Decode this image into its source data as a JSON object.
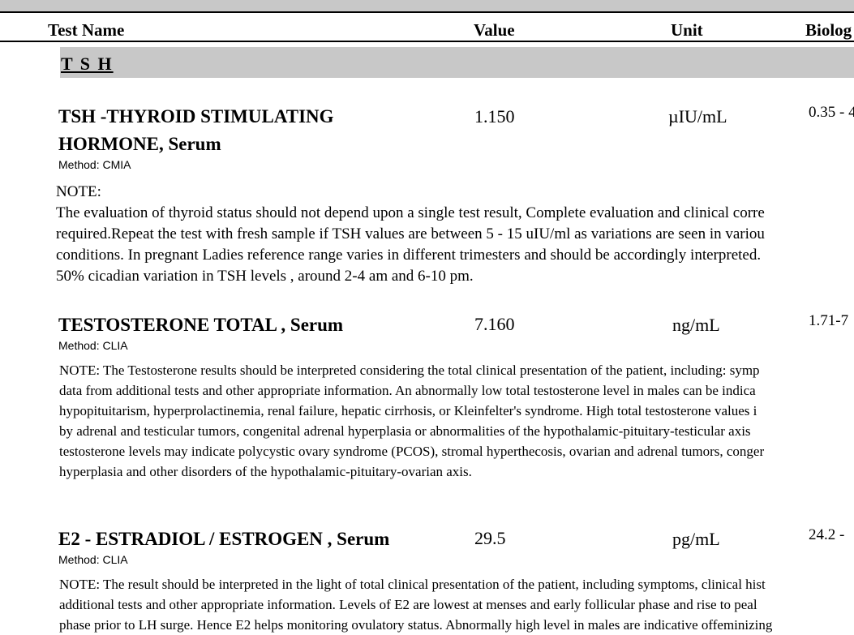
{
  "header": {
    "test_name": "Test Name",
    "value": "Value",
    "unit": "Unit",
    "bio": "Biolog"
  },
  "section": {
    "title": "T S H"
  },
  "tests": [
    {
      "name": "TSH -THYROID STIMULATING HORMONE, Serum",
      "method": "Method: CMIA",
      "value": "1.150",
      "unit": "µIU/mL",
      "range": "0.35 - 4",
      "note_lines": [
        "NOTE:",
        "The evaluation of thyroid status should not depend upon a single test result, Complete evaluation and clinical corre",
        "required.Repeat the test with fresh sample if TSH values are between 5 - 15 uIU/ml as variations are seen in variou",
        "conditions. In pregnant Ladies reference range varies in different trimesters and should be accordingly interpreted.",
        "50% cicadian variation in TSH levels , around 2-4 am and 6-10 pm."
      ]
    },
    {
      "name": "TESTOSTERONE TOTAL , Serum",
      "method": "Method: CLIA",
      "value": "7.160",
      "unit": "ng/mL",
      "range": "1.71-7",
      "note_lines": [
        "NOTE: The Testosterone results should be interpreted considering the total clinical presentation of the patient, including: symp",
        "data from additional tests and other appropriate information. An abnormally low total testosterone level in males can be indica",
        "hypopituitarism, hyperprolactinemia, renal failure, hepatic cirrhosis, or Kleinfelter's syndrome. High total testosterone values i",
        "by adrenal and testicular tumors, congenital adrenal hyperplasia or abnormalities of the hypothalamic-pituitary-testicular axis",
        "testosterone levels may indicate polycystic ovary syndrome (PCOS), stromal hyperthecosis, ovarian and adrenal tumors, conger",
        "hyperplasia and other disorders of the hypothalamic-pituitary-ovarian axis."
      ]
    },
    {
      "name": "E2 - ESTRADIOL / ESTROGEN , Serum",
      "method": "Method: CLIA",
      "value": "29.5",
      "unit": "pg/mL",
      "range": "24.2 -",
      "note_lines": [
        "NOTE: The result should be interpreted in the light of total clinical presentation of the patient, including symptoms, clinical hist",
        "additional tests and other appropriate information. Levels of E2 are lowest at menses and early follicular phase and rise to peal",
        "phase prior to LH surge. Hence E2 helps monitoring ovulatory status. Abnormally high level in males are indicative offeminizing"
      ]
    }
  ]
}
